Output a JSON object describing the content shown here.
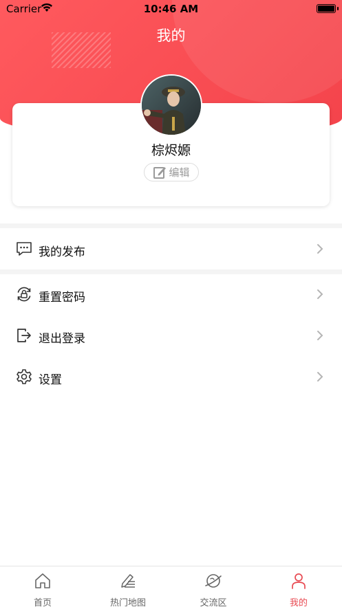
{
  "status_bar": {
    "carrier": "Carrier",
    "time": "10:46 AM"
  },
  "header": {
    "title": "我的"
  },
  "profile": {
    "username": "棕烬嫄",
    "edit_label": "编辑"
  },
  "menu": {
    "group1": [
      {
        "label": "我的发布",
        "icon": "message-dots-icon"
      }
    ],
    "group2": [
      {
        "label": "重置密码",
        "icon": "reset-lock-icon"
      },
      {
        "label": "退出登录",
        "icon": "logout-icon"
      },
      {
        "label": "设置",
        "icon": "gear-icon"
      }
    ]
  },
  "tabbar": {
    "items": [
      {
        "label": "首页",
        "icon": "home-icon",
        "active": false
      },
      {
        "label": "热门地图",
        "icon": "edit-list-icon",
        "active": false
      },
      {
        "label": "交流区",
        "icon": "planet-icon",
        "active": false
      },
      {
        "label": "我的",
        "icon": "user-icon",
        "active": true
      }
    ]
  },
  "colors": {
    "accent": "#f4434b",
    "active_tab": "#e84a52",
    "divider": "#f4f4f4"
  }
}
